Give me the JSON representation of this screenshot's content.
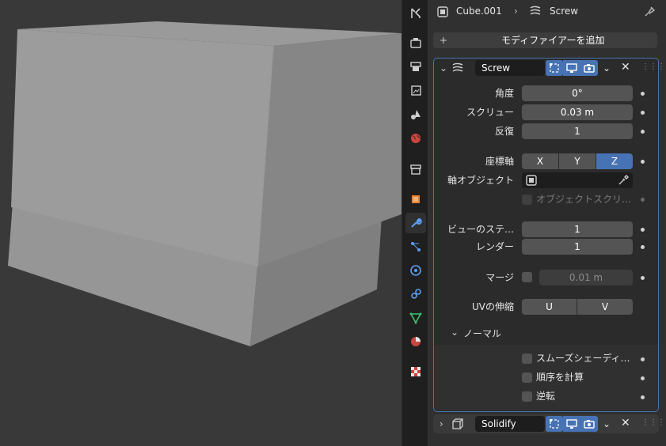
{
  "header": {
    "object_name": "Cube.001",
    "modifier_name": "Screw"
  },
  "add_modifier_label": "モディファイアーを追加",
  "screw": {
    "name": "Screw",
    "angle_label": "角度",
    "angle_value": "0°",
    "screw_label": "スクリュー",
    "screw_value": "0.03 m",
    "iterations_label": "反復",
    "iterations_value": "1",
    "axis_label": "座標軸",
    "axis_x": "X",
    "axis_y": "Y",
    "axis_z": "Z",
    "axis_object_label": "軸オブジェクト",
    "object_screw_label": "オブジェクトスクリ…",
    "viewport_steps_label": "ビューのステ…",
    "viewport_steps_value": "1",
    "render_label": "レンダー",
    "render_value": "1",
    "merge_label": "マージ",
    "merge_value": "0.01 m",
    "uv_stretch_label": "UVの伸縮",
    "uv_u": "U",
    "uv_v": "V",
    "normals_label": "ノーマル",
    "smooth_shading_label": "スムーズシェーディ…",
    "calc_order_label": "順序を計算",
    "flip_label": "逆転"
  },
  "solidify": {
    "name": "Solidify"
  },
  "colors": {
    "accent": "#4772b3",
    "viewport_bg": "#393939",
    "panel_bg": "#303030"
  }
}
